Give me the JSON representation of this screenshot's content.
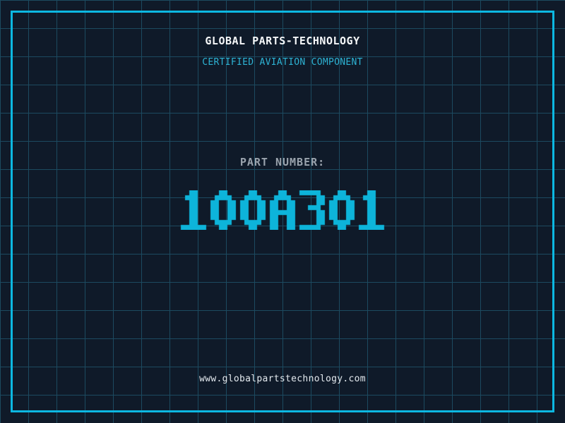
{
  "header": {
    "title": "GLOBAL PARTS-TECHNOLOGY",
    "subtitle": "CERTIFIED AVIATION COMPONENT"
  },
  "part_number": {
    "label": "PART NUMBER:",
    "value": "100A301"
  },
  "footer": {
    "website": "www.globalpartstechnology.com"
  },
  "colors": {
    "background": "#0f1a29",
    "grid_line": "#1c4a60",
    "frame": "#0cb8e2",
    "title_text": "#f5f7f8",
    "subtitle_text": "#2db3d4",
    "label_text": "#9aa3ad",
    "part_number_text": "#0db4da",
    "url_text": "#e3e9ee"
  }
}
